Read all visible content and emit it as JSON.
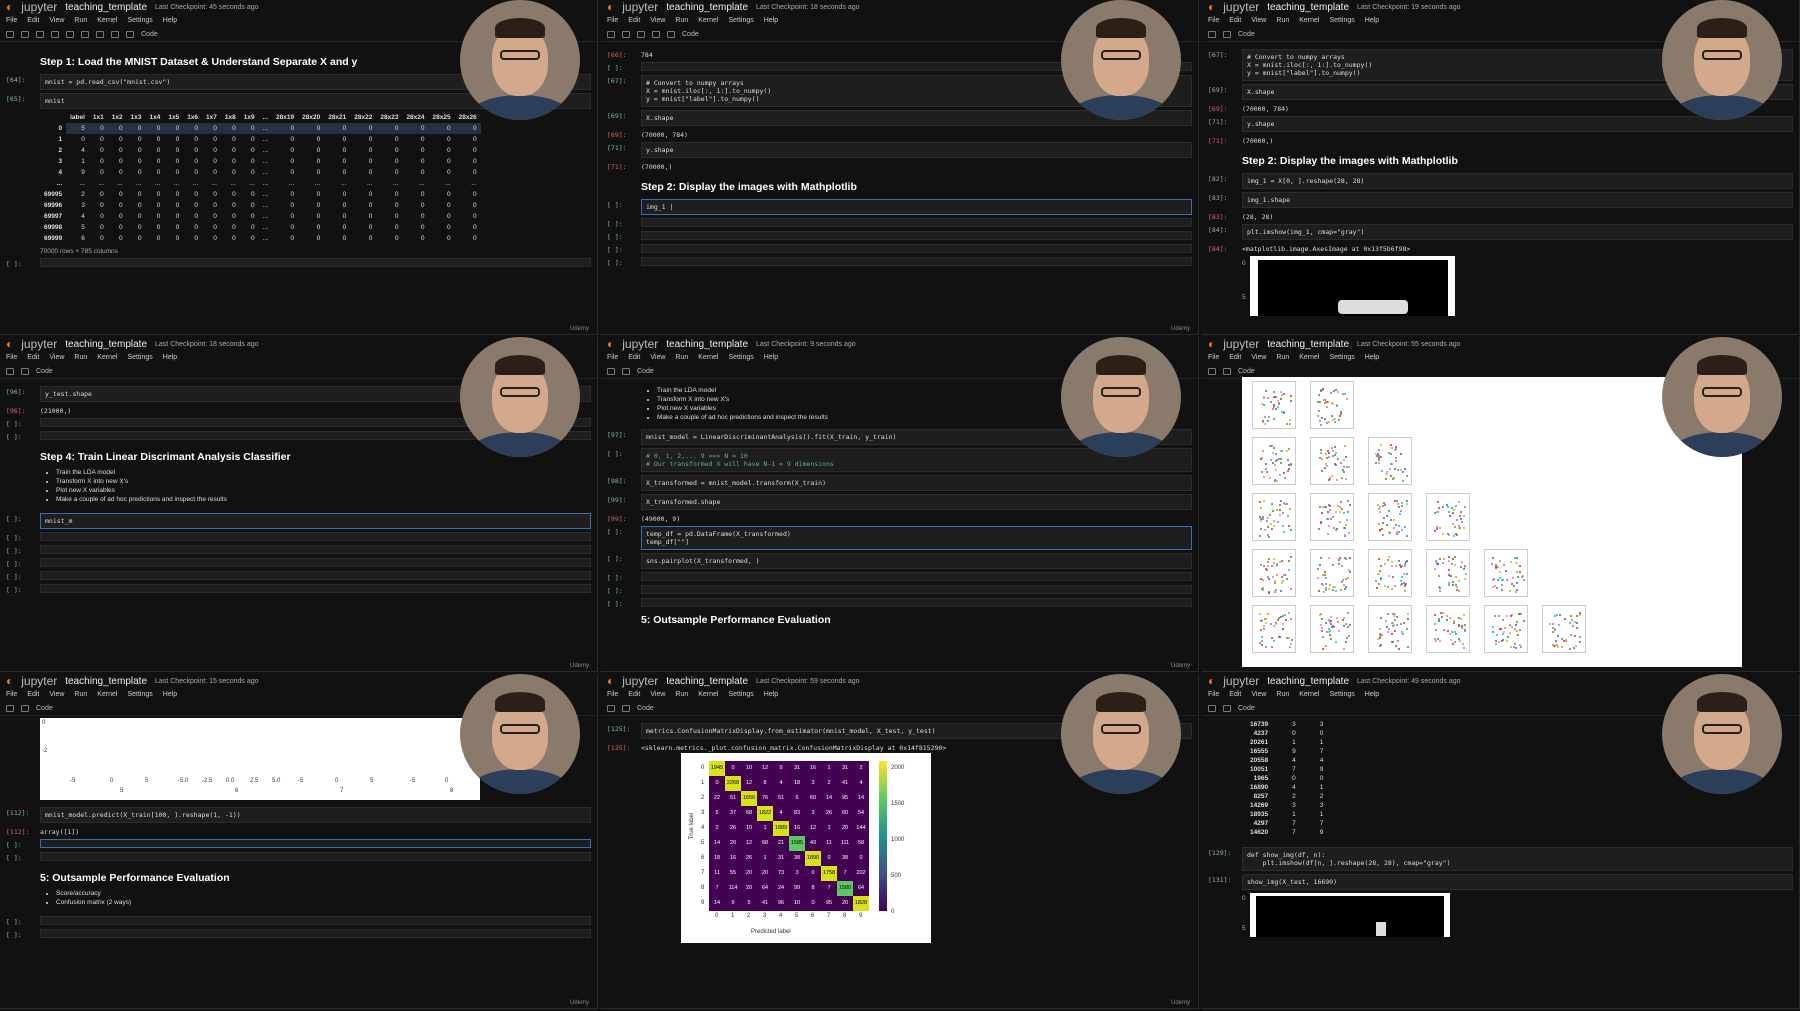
{
  "app": {
    "jupyter_label": "jupyter",
    "notebook_title": "teaching_template",
    "menu": [
      "File",
      "Edit",
      "View",
      "Run",
      "Kernel",
      "Settings",
      "Help"
    ],
    "cell_type": "Code",
    "watermark": "Udemy"
  },
  "panels": [
    {
      "id": "p1",
      "checkpoint": "Last Checkpoint: 45 seconds ago",
      "heading": "Step 1: Load the MNIST Dataset & Understand Separate X and y",
      "cells": [
        {
          "prompt": "[64]:",
          "code": "mnist = pd.read_csv(\"mnist.csv\")"
        },
        {
          "prompt": "[65]:",
          "code": "mnist"
        }
      ],
      "table_headers": [
        "",
        "label",
        "1x1",
        "1x2",
        "1x3",
        "1x4",
        "1x5",
        "1x6",
        "1x7",
        "1x8",
        "1x9",
        "...",
        "28x19",
        "28x20",
        "28x21",
        "28x22",
        "28x23",
        "28x24",
        "28x25",
        "28x26"
      ],
      "table_rows": [
        [
          "0",
          "5",
          "0",
          "0",
          "0",
          "0",
          "0",
          "0",
          "0",
          "0",
          "0",
          "...",
          "0",
          "0",
          "0",
          "0",
          "0",
          "0",
          "0",
          "0"
        ],
        [
          "1",
          "0",
          "0",
          "0",
          "0",
          "0",
          "0",
          "0",
          "0",
          "0",
          "0",
          "...",
          "0",
          "0",
          "0",
          "0",
          "0",
          "0",
          "0",
          "0"
        ],
        [
          "2",
          "4",
          "0",
          "0",
          "0",
          "0",
          "0",
          "0",
          "0",
          "0",
          "0",
          "...",
          "0",
          "0",
          "0",
          "0",
          "0",
          "0",
          "0",
          "0"
        ],
        [
          "3",
          "1",
          "0",
          "0",
          "0",
          "0",
          "0",
          "0",
          "0",
          "0",
          "0",
          "...",
          "0",
          "0",
          "0",
          "0",
          "0",
          "0",
          "0",
          "0"
        ],
        [
          "4",
          "9",
          "0",
          "0",
          "0",
          "0",
          "0",
          "0",
          "0",
          "0",
          "0",
          "...",
          "0",
          "0",
          "0",
          "0",
          "0",
          "0",
          "0",
          "0"
        ],
        [
          "...",
          "...",
          "...",
          "...",
          "...",
          "...",
          "...",
          "...",
          "...",
          "...",
          "...",
          "...",
          "...",
          "...",
          "...",
          "...",
          "...",
          "...",
          "...",
          "..."
        ],
        [
          "69995",
          "2",
          "0",
          "0",
          "0",
          "0",
          "0",
          "0",
          "0",
          "0",
          "0",
          "...",
          "0",
          "0",
          "0",
          "0",
          "0",
          "0",
          "0",
          "0"
        ],
        [
          "69996",
          "3",
          "0",
          "0",
          "0",
          "0",
          "0",
          "0",
          "0",
          "0",
          "0",
          "...",
          "0",
          "0",
          "0",
          "0",
          "0",
          "0",
          "0",
          "0"
        ],
        [
          "69997",
          "4",
          "0",
          "0",
          "0",
          "0",
          "0",
          "0",
          "0",
          "0",
          "0",
          "...",
          "0",
          "0",
          "0",
          "0",
          "0",
          "0",
          "0",
          "0"
        ],
        [
          "69998",
          "5",
          "0",
          "0",
          "0",
          "0",
          "0",
          "0",
          "0",
          "0",
          "0",
          "...",
          "0",
          "0",
          "0",
          "0",
          "0",
          "0",
          "0",
          "0"
        ],
        [
          "69999",
          "6",
          "0",
          "0",
          "0",
          "0",
          "0",
          "0",
          "0",
          "0",
          "0",
          "...",
          "0",
          "0",
          "0",
          "0",
          "0",
          "0",
          "0",
          "0"
        ]
      ],
      "table_footer": "70000 rows × 785 columns",
      "empty_prompt": "[ ]:"
    },
    {
      "id": "p2",
      "checkpoint": "Last Checkpoint: 18 seconds ago",
      "cells_top": [
        {
          "prompt": "[66]:",
          "output": "784"
        },
        {
          "prompt": "[ ]:",
          "code": ""
        },
        {
          "prompt": "[67]:",
          "code": "# Convert to numpy arrays\nX = mnist.iloc[:, 1:].to_numpy()\ny = mnist[\"label\"].to_numpy()"
        },
        {
          "prompt": "[69]:",
          "code": "X.shape"
        },
        {
          "prompt": "[69]:",
          "output": "(70000, 784)"
        },
        {
          "prompt": "[71]:",
          "code": "y.shape"
        },
        {
          "prompt": "[71]:",
          "output": "(70000,)"
        }
      ],
      "heading": "Step 2: Display the images with Mathplotlib",
      "active_code": "img_1 |",
      "empty_prompt": "[ ]:"
    },
    {
      "id": "p3",
      "checkpoint": "Last Checkpoint: 19 seconds ago",
      "cells_top": [
        {
          "prompt": "[67]:",
          "code": "# Convert to numpy arrays\nX = mnist.iloc[:, 1:].to_numpy()\ny = mnist[\"label\"].to_numpy()"
        },
        {
          "prompt": "[69]:",
          "code": "X.shape"
        },
        {
          "prompt": "[69]:",
          "output": "(70000, 784)"
        },
        {
          "prompt": "[71]:",
          "code": "y.shape"
        },
        {
          "prompt": "[71]:",
          "output": "(70000,)"
        }
      ],
      "heading": "Step 2: Display the images with Mathplotlib",
      "cells_bottom": [
        {
          "prompt": "[82]:",
          "code": "img_1 = X[0, ].reshape(28, 28)"
        },
        {
          "prompt": "[83]:",
          "code": "img_1.shape"
        },
        {
          "prompt": "[83]:",
          "output": "(28, 28)"
        },
        {
          "prompt": "[84]:",
          "code": "plt.imshow(img_1, cmap=\"gray\")"
        },
        {
          "prompt": "[84]:",
          "output": "<matplotlib.image.AxesImage at 0x13f5b6f98>"
        }
      ],
      "axis_ticks": [
        "0",
        "5"
      ]
    },
    {
      "id": "p4",
      "checkpoint": "Last Checkpoint: 18 seconds ago",
      "cells_top": [
        {
          "prompt": "[96]:",
          "code": "y_test.shape"
        },
        {
          "prompt": "[96]:",
          "output": "(21000,)"
        },
        {
          "prompt": "[ ]:",
          "code": ""
        },
        {
          "prompt": "[ ]:",
          "code": ""
        }
      ],
      "heading": "Step 4: Train Linear Discrimant Analysis Classifier",
      "bullets": [
        "Train the LDA model",
        "Transform X into new X's",
        "Plot new X variables",
        "Make a couple of ad hoc predictions and inspect the results"
      ],
      "active_code": "mnist_m",
      "empty_prompt": "[ ]:"
    },
    {
      "id": "p5",
      "checkpoint": "Last Checkpoint: 9 seconds ago",
      "bullets": [
        "Train the LDA model",
        "Transform X into new X's",
        "Plot new X variables",
        "Make a couple of ad hoc predictions and inspect the results"
      ],
      "cells": [
        {
          "prompt": "[97]:",
          "code": "mnist_model = LinearDiscriminantAnalysis().fit(X_train, y_train)"
        },
        {
          "prompt": "[ ]:",
          "code": "# 0, 1, 2,... 9 ==> N = 10\n# Our transformed X will have N-1 = 9 dimensions"
        },
        {
          "prompt": "[98]:",
          "code": "X_transformed = mnist_model.transform(X_train)"
        },
        {
          "prompt": "[99]:",
          "code": "X_transformed.shape"
        },
        {
          "prompt": "[99]:",
          "output": "(49000, 9)"
        },
        {
          "prompt": "[ ]:",
          "code": "temp_df = pd.DataFrame(X_transformed)\ntemp_df[\"\"]"
        },
        {
          "prompt": "[ ]:",
          "code": "sns.pairplot(X_transformed, )"
        }
      ],
      "heading": "5: Outsample Performance Evaluation",
      "empty_prompt": "[ ]:"
    },
    {
      "id": "p6",
      "checkpoint": "Last Checkpoint: 55 seconds ago"
    },
    {
      "id": "p7",
      "checkpoint": "Last Checkpoint: 15 seconds ago",
      "plot_ticks": [
        "-5",
        "0",
        "5",
        "-5.0",
        "-2.5",
        "0.0",
        "2.5",
        "5.0",
        "-5",
        "0",
        "5",
        "-5",
        "0"
      ],
      "plot_xlabels": [
        "5",
        "6",
        "7",
        "8"
      ],
      "plot_yticks": [
        "0",
        "-2"
      ],
      "cells": [
        {
          "prompt": "[112]:",
          "code": "mnist_model.predict(X_train[100, ].reshape(1, -1))"
        },
        {
          "prompt": "[112]:",
          "output": "array([1])"
        }
      ],
      "heading": "5: Outsample Performance Evaluation",
      "bullets": [
        "Score/accuracy",
        "Confusion matrix (2 ways)"
      ],
      "empty_prompt": "[ ]:"
    },
    {
      "id": "p8",
      "checkpoint": "Last Checkpoint: 59 seconds ago",
      "cells": [
        {
          "prompt": "[125]:",
          "code": "metrics.ConfusionMatrixDisplay.from_estimator(mnist_model, X_test, y_test)"
        },
        {
          "prompt": "[125]:",
          "output": "<sklearn.metrics._plot.confusion_matrix.ConfusionMatrixDisplay at 0x14f815290>"
        }
      ],
      "cm_ylabel": "True label",
      "cm_xlabel": "Predicted label",
      "cm_labels": [
        "0",
        "1",
        "2",
        "3",
        "4",
        "5",
        "6",
        "7",
        "8",
        "9"
      ],
      "cm_colorbar": [
        "2000",
        "1500",
        "1000",
        "500",
        "0"
      ],
      "cm_values": [
        [
          1945,
          0,
          10,
          12,
          9,
          31,
          16,
          1,
          31,
          2
        ],
        [
          0,
          2268,
          12,
          8,
          4,
          18,
          3,
          2,
          41,
          4
        ],
        [
          22,
          51,
          1656,
          76,
          51,
          6,
          60,
          14,
          95,
          14
        ],
        [
          5,
          37,
          68,
          1822,
          4,
          83,
          3,
          26,
          60,
          54
        ],
        [
          2,
          26,
          10,
          1,
          1889,
          16,
          12,
          1,
          20,
          144
        ],
        [
          14,
          20,
          12,
          68,
          21,
          1585,
          43,
          11,
          111,
          58
        ],
        [
          18,
          16,
          26,
          1,
          31,
          38,
          1890,
          0,
          38,
          0
        ],
        [
          11,
          55,
          20,
          20,
          73,
          3,
          0,
          1758,
          7,
          202
        ],
        [
          7,
          114,
          20,
          64,
          24,
          99,
          8,
          7,
          1580,
          64
        ],
        [
          14,
          9,
          5,
          41,
          96,
          10,
          0,
          95,
          20,
          1828
        ]
      ]
    },
    {
      "id": "p9",
      "checkpoint": "Last Checkpoint: 49 seconds ago",
      "rows": [
        [
          "16739",
          "3",
          "3"
        ],
        [
          "4237",
          "0",
          "0"
        ],
        [
          "20261",
          "1",
          "1"
        ],
        [
          "16555",
          "9",
          "7"
        ],
        [
          "20558",
          "4",
          "4"
        ],
        [
          "10051",
          "7",
          "9"
        ],
        [
          "1965",
          "0",
          "0"
        ],
        [
          "16890",
          "4",
          "1"
        ],
        [
          "8257",
          "2",
          "2"
        ],
        [
          "14269",
          "3",
          "3"
        ],
        [
          "18935",
          "1",
          "1"
        ],
        [
          "4297",
          "7",
          "7"
        ],
        [
          "14620",
          "7",
          "9"
        ]
      ],
      "cells": [
        {
          "prompt": "[129]:",
          "code": "def show_img(df, n):\n    plt.imshow(df[n, ].reshape(28, 28), cmap=\"gray\")"
        },
        {
          "prompt": "[131]:",
          "code": "show_img(X_test, 16690)"
        }
      ],
      "axis_ticks": [
        "0",
        "5"
      ]
    }
  ]
}
